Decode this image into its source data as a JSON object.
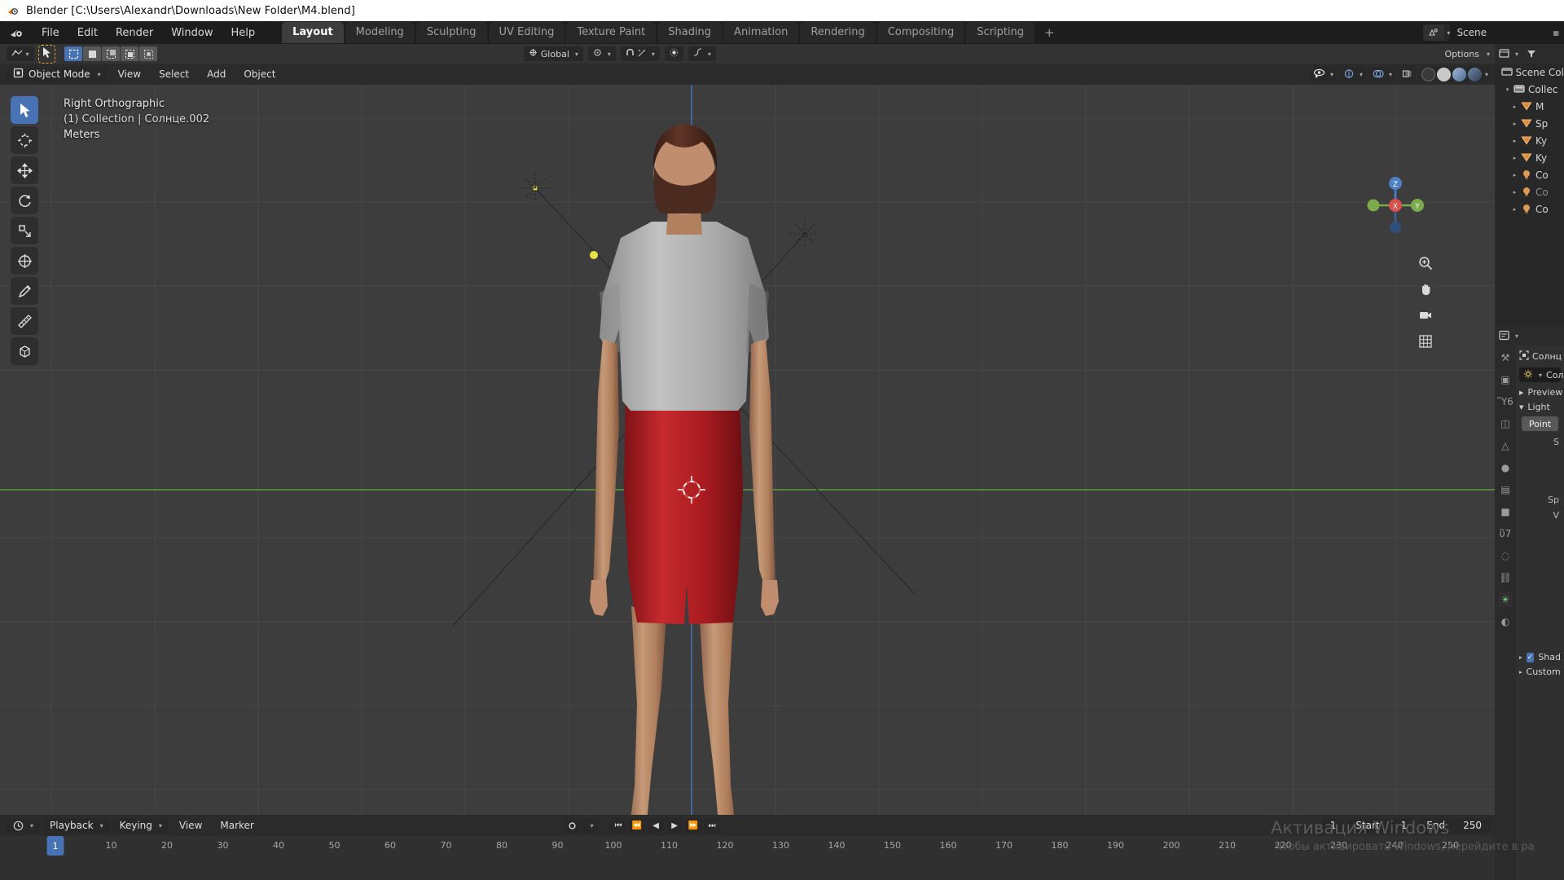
{
  "window": {
    "title": "Blender [C:\\Users\\Alexandr\\Downloads\\New Folder\\M4.blend]",
    "app_icon": "blender-logo-icon"
  },
  "topbar": {
    "menus": [
      "File",
      "Edit",
      "Render",
      "Window",
      "Help"
    ],
    "workspaces": [
      {
        "label": "Layout",
        "active": true
      },
      {
        "label": "Modeling",
        "active": false
      },
      {
        "label": "Sculpting",
        "active": false
      },
      {
        "label": "UV Editing",
        "active": false
      },
      {
        "label": "Texture Paint",
        "active": false
      },
      {
        "label": "Shading",
        "active": false
      },
      {
        "label": "Animation",
        "active": false
      },
      {
        "label": "Rendering",
        "active": false
      },
      {
        "label": "Compositing",
        "active": false
      },
      {
        "label": "Scripting",
        "active": false
      }
    ],
    "add_workspace": "+",
    "scene_icon": "scene-icon",
    "scene_name": "Scene",
    "viewlayer_icon": "view-layer-icon"
  },
  "tool_header": {
    "editor_type_icon": "editor-type-icon",
    "select_tool_icon": "cursor-arrow-icon",
    "select_modes": [
      {
        "name": "set-select-mode",
        "active": true
      },
      {
        "name": "extend-select-mode",
        "active": false
      },
      {
        "name": "subtract-select-mode",
        "active": false
      },
      {
        "name": "invert-select-mode",
        "active": false
      },
      {
        "name": "intersect-select-mode",
        "active": false
      }
    ],
    "transform_orientation_icon": "orientation-icon",
    "transform_orientation": "Global",
    "pivot_icon": "pivot-point-icon",
    "snap_icon": "magnet-icon",
    "proportional_icon": "proportional-edit-icon",
    "falloff_icon": "falloff-curve-icon",
    "options_label": "Options"
  },
  "viewport_header": {
    "mode": "Object Mode",
    "mode_icon": "object-mode-icon",
    "menus": [
      "View",
      "Select",
      "Add",
      "Object"
    ],
    "visibility_icon": "eye-visibility-icon",
    "gizmo_icon": "gizmo-icon",
    "overlays_icon": "overlays-icon",
    "xray_icon": "xray-toggle-icon",
    "shading_modes": [
      "wireframe",
      "solid",
      "material-preview",
      "rendered"
    ],
    "shading_active": "solid"
  },
  "viewport": {
    "overlay_lines": [
      "Right Orthographic",
      "(1) Collection | Солнце.002",
      "Meters"
    ],
    "tools": [
      {
        "name": "tweak-tool",
        "icon": "cursor-arrow-icon",
        "active": true
      },
      {
        "name": "cursor-tool",
        "icon": "3d-cursor-icon",
        "active": false
      },
      {
        "name": "move-tool",
        "icon": "move-arrows-icon",
        "active": false
      },
      {
        "name": "rotate-tool",
        "icon": "rotate-icon",
        "active": false
      },
      {
        "name": "scale-tool",
        "icon": "scale-icon",
        "active": false
      },
      {
        "name": "transform-tool",
        "icon": "transform-icon",
        "active": false
      },
      {
        "name": "annotate-tool",
        "icon": "pencil-icon",
        "active": false
      },
      {
        "name": "measure-tool",
        "icon": "ruler-icon",
        "active": false
      },
      {
        "name": "add-cube-tool",
        "icon": "add-cube-icon",
        "active": false
      }
    ],
    "gizmo_axes": {
      "x": "X",
      "y": "Y",
      "z": "Z"
    },
    "nav_icons": [
      "zoom-icon",
      "hand-pan-icon",
      "camera-icon",
      "grid-ortho-icon"
    ],
    "colors": {
      "background": "#3d3d3d",
      "grid": "#4a4a4a",
      "axis_z": "#4e7fc4",
      "axis_y": "#5ea13c",
      "skin": "#c08d6e",
      "shirt": "#b4b4b4",
      "shorts": "#b01f23",
      "hair": "#4b2a20",
      "light_dot": "#e8e14a",
      "axis_x_gizmo": "#d9504e",
      "axis_y_gizmo": "#8fbc4b",
      "axis_z_gizmo": "#4e7fc4"
    }
  },
  "outliner": {
    "display_mode_icon": "outliner-icon",
    "filter_icon": "filter-icon",
    "search_icon": "search-icon",
    "rows": [
      {
        "label": "Scene Col",
        "icon": "scene-collection-icon",
        "indent": 0,
        "arrow": "",
        "dim": false
      },
      {
        "label": "Collec",
        "icon": "collection-icon",
        "indent": 1,
        "arrow": "▼",
        "dim": false
      },
      {
        "label": "M",
        "icon": "mesh-icon",
        "indent": 2,
        "arrow": "▶",
        "dim": false
      },
      {
        "label": "Sp",
        "icon": "mesh-icon",
        "indent": 2,
        "arrow": "▶",
        "dim": false
      },
      {
        "label": "Ky",
        "icon": "mesh-icon",
        "indent": 2,
        "arrow": "▶",
        "dim": false
      },
      {
        "label": "Ky",
        "icon": "mesh-icon",
        "indent": 2,
        "arrow": "▶",
        "dim": false
      },
      {
        "label": "Co",
        "icon": "light-icon",
        "indent": 2,
        "arrow": "▶",
        "dim": false
      },
      {
        "label": "Co",
        "icon": "light-icon",
        "indent": 2,
        "arrow": "▶",
        "dim": true
      },
      {
        "label": "Co",
        "icon": "light-icon",
        "indent": 2,
        "arrow": "▶",
        "dim": false
      }
    ]
  },
  "properties": {
    "editor_icon": "properties-editor-icon",
    "tabs": [
      {
        "name": "tool-tab",
        "glyph": "⚒",
        "active": false
      },
      {
        "name": "render-tab",
        "glyph": "▣",
        "active": false
      },
      {
        "name": "output-tab",
        "glyph": "Ὓ6",
        "active": false
      },
      {
        "name": "view-layer-tab",
        "glyph": "◫",
        "active": false
      },
      {
        "name": "scene-tab",
        "glyph": "△",
        "active": false
      },
      {
        "name": "world-tab",
        "glyph": "●",
        "active": false
      },
      {
        "name": "collection-tab",
        "glyph": "▤",
        "active": false
      },
      {
        "name": "object-tab",
        "glyph": "■",
        "active": false
      },
      {
        "name": "modifier-tab",
        "glyph": "ὒ7",
        "active": false
      },
      {
        "name": "physics-tab",
        "glyph": "◌",
        "active": false
      },
      {
        "name": "constraint-tab",
        "glyph": "⛓",
        "active": false
      },
      {
        "name": "data-tab",
        "glyph": "☀",
        "active": true
      },
      {
        "name": "material-tab",
        "glyph": "◐",
        "active": false
      }
    ],
    "breadcrumb_icon": "object-data-icon",
    "breadcrumb": "Солнц",
    "datablock_icon": "light-data-icon",
    "datablock_name": "Сол",
    "sections": [
      {
        "label": "Preview",
        "arrow": "▶",
        "open": false
      },
      {
        "label": "Light",
        "arrow": "▼",
        "open": true
      }
    ],
    "light_type": "Point",
    "light_fields": [
      "S",
      "Sp",
      "V"
    ],
    "shadow_label": "Shad",
    "shadow_checked": true,
    "custom_label": "Custom"
  },
  "timeline": {
    "editor_icon": "timeline-editor-icon",
    "menus": [
      {
        "label": "Playback",
        "dropdown": true
      },
      {
        "label": "Keying",
        "dropdown": true
      },
      {
        "label": "View",
        "dropdown": false
      },
      {
        "label": "Marker",
        "dropdown": false
      }
    ],
    "autokey_icon": "record-icon",
    "transport": [
      {
        "name": "jump-to-start-button",
        "glyph": "⏮"
      },
      {
        "name": "jump-prev-keyframe-button",
        "glyph": "⏪"
      },
      {
        "name": "play-reverse-button",
        "glyph": "◀"
      },
      {
        "name": "play-button",
        "glyph": "▶"
      },
      {
        "name": "jump-next-keyframe-button",
        "glyph": "⏩"
      },
      {
        "name": "jump-to-end-button",
        "glyph": "⏭"
      }
    ],
    "current_frame": "1",
    "start_label": "Start",
    "start_value": "1",
    "end_label": "End",
    "end_value": "250",
    "playhead_frame": "1",
    "ruler_ticks": [
      10,
      20,
      30,
      40,
      50,
      60,
      70,
      80,
      90,
      100,
      110,
      120,
      130,
      140,
      150,
      160,
      170,
      180,
      190,
      200,
      210,
      220,
      230,
      240,
      250
    ]
  },
  "watermark": {
    "line1": "Активация Windows",
    "line2": "Чтобы активировать Windows, перейдите в ра"
  }
}
